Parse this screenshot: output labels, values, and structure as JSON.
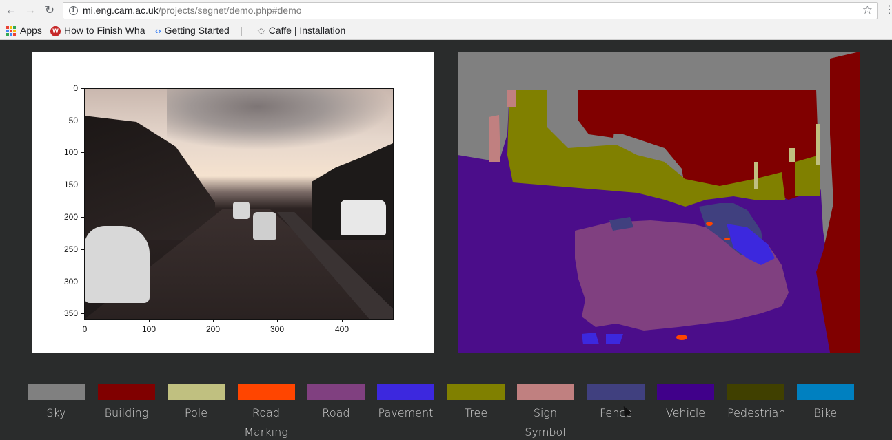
{
  "browser": {
    "url_host": "mi.eng.cam.ac.uk",
    "url_path": "/projects/segnet/demo.php#demo",
    "back_icon": "back-arrow-icon",
    "forward_icon": "forward-arrow-icon",
    "reload_icon": "reload-icon"
  },
  "bookmarks": [
    {
      "label": "Apps",
      "icon": "apps-grid-icon"
    },
    {
      "label": "How to Finish Wha",
      "icon": "red-w-icon"
    },
    {
      "label": "Getting Started",
      "icon": "getting-started-icon"
    },
    {
      "label": "Caffe | Installation",
      "icon": "caffe-icon"
    }
  ],
  "input_plot": {
    "y_ticks": [
      "0",
      "50",
      "100",
      "150",
      "200",
      "250",
      "300",
      "350"
    ],
    "x_ticks": [
      "0",
      "100",
      "200",
      "300",
      "400"
    ]
  },
  "legend": [
    {
      "label": "Sky",
      "color": "#808080"
    },
    {
      "label": "Building",
      "color": "#800000"
    },
    {
      "label": "Pole",
      "color": "#c0c080"
    },
    {
      "label": "Road Marking",
      "color": "#ff4500"
    },
    {
      "label": "Road",
      "color": "#804080"
    },
    {
      "label": "Pavement",
      "color": "#3c28de"
    },
    {
      "label": "Tree",
      "color": "#808000"
    },
    {
      "label": "Sign Symbol",
      "color": "#c08080"
    },
    {
      "label": "Fence",
      "color": "#40407f"
    },
    {
      "label": "Vehicle",
      "color": "#40008a"
    },
    {
      "label": "Pedestrian",
      "color": "#404000"
    },
    {
      "label": "Bike",
      "color": "#0080c0"
    }
  ]
}
